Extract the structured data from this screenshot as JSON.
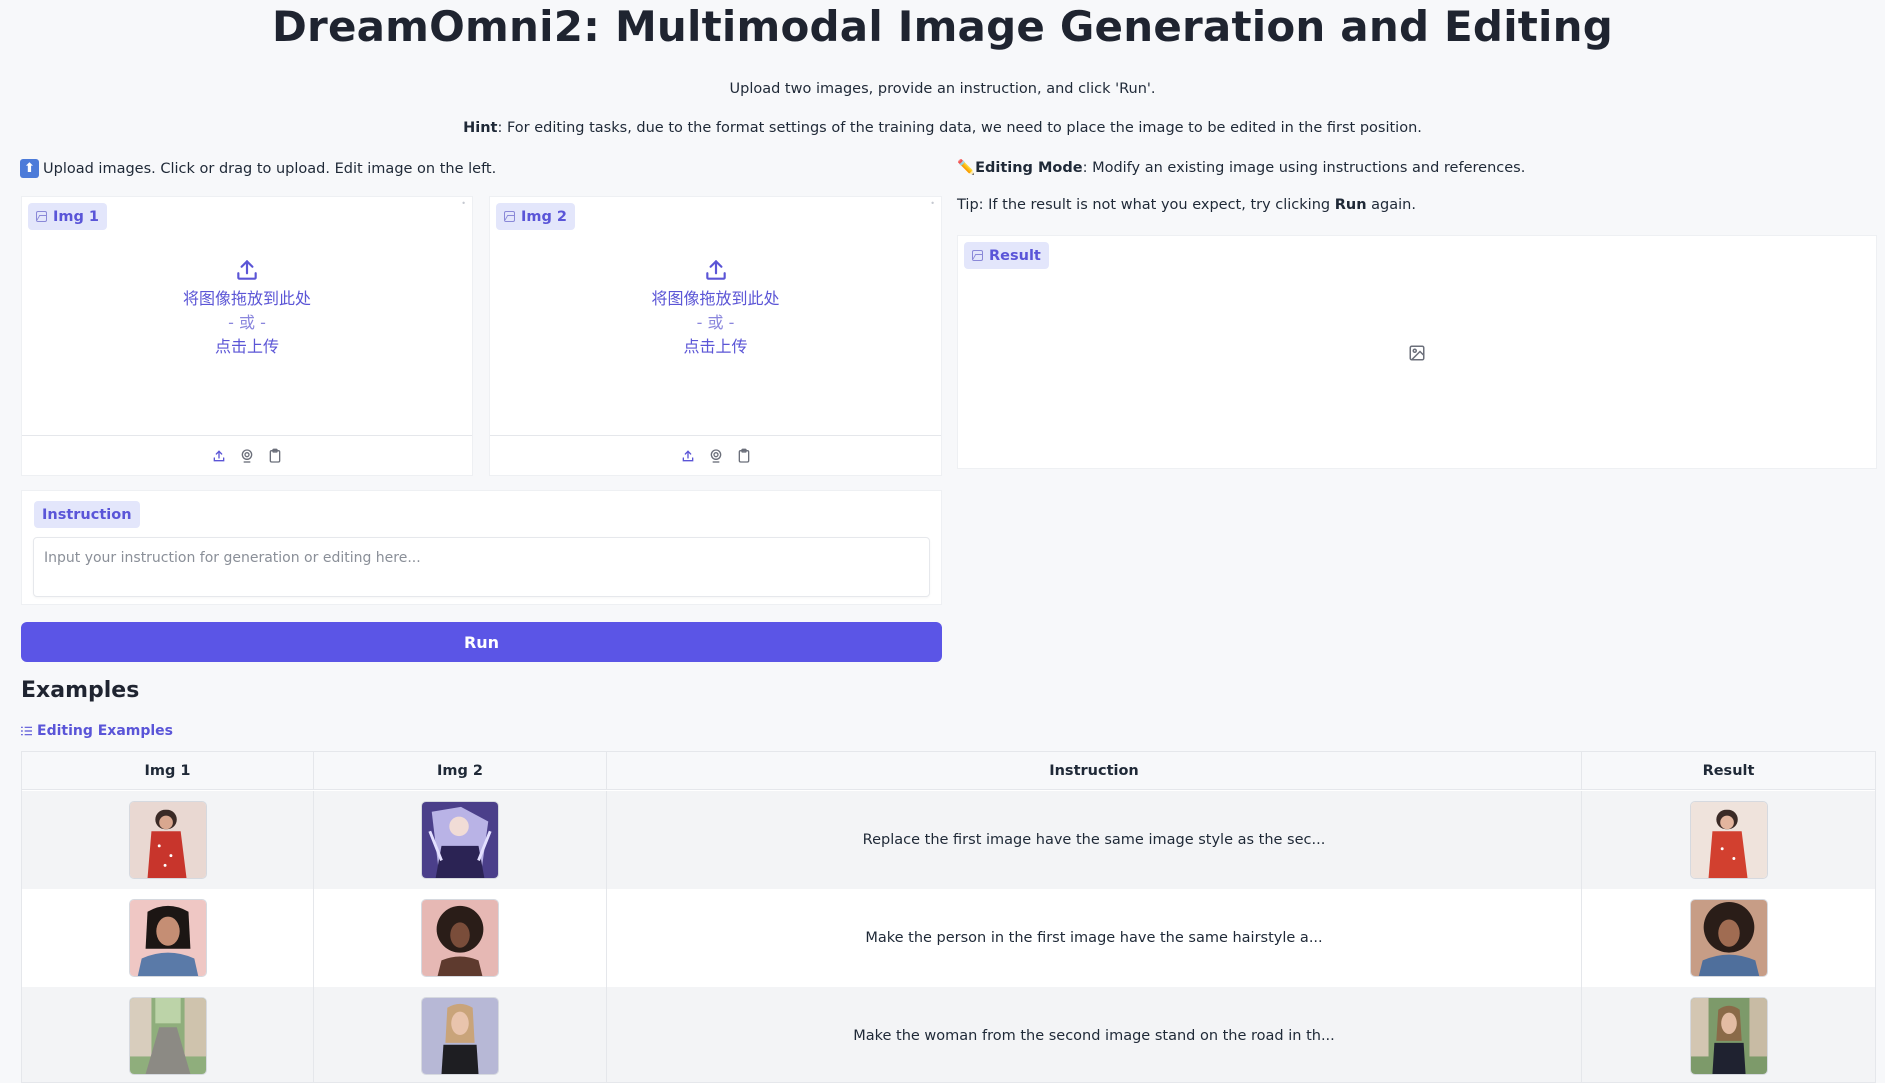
{
  "title": "DreamOmni2: Multimodal Image Generation and Editing",
  "subtitle": "Upload two images, provide an instruction, and click 'Run'.",
  "hint": {
    "label": "Hint",
    "text": ": For editing tasks, due to the format settings of the training data, we need to place the image to be edited in the first position."
  },
  "upload_note": {
    "emoji": "⬆",
    "text": "Upload images. Click or drag to upload. Edit image on the left."
  },
  "mode_note": {
    "emoji": "✏️",
    "label": "Editing Mode",
    "text": ": Modify an existing image using instructions and references."
  },
  "tip_note": {
    "prefix": "Tip: If the result is not what you expect, try clicking ",
    "bold": "Run",
    "suffix": " again."
  },
  "img1": {
    "label": "Img 1",
    "drop_text": "将图像拖放到此处",
    "or_text": "- 或 -",
    "click_text": "点击上传"
  },
  "img2": {
    "label": "Img 2",
    "drop_text": "将图像拖放到此处",
    "or_text": "- 或 -",
    "click_text": "点击上传"
  },
  "result": {
    "label": "Result"
  },
  "instruction": {
    "label": "Instruction",
    "placeholder": "Input your instruction for generation or editing here..."
  },
  "run_label": "Run",
  "examples": {
    "title": "Examples",
    "subtitle": "Editing Examples",
    "headers": [
      "Img 1",
      "Img 2",
      "Instruction",
      "Result"
    ],
    "rows": [
      {
        "instruction": "Replace the first image have the same image style as the sec..."
      },
      {
        "instruction": "Make the person in the first image have the same hairstyle a..."
      },
      {
        "instruction": "Make the woman from the second image stand on the road in th..."
      }
    ]
  },
  "colors": {
    "accent": "#5b55e6",
    "chip_bg": "#e3e6fb",
    "chip_text": "#5a55d8",
    "background": "#f7f8fa"
  },
  "icons": {
    "upload": "upload-icon",
    "webcam": "webcam-icon",
    "clipboard": "clipboard-icon",
    "image": "image-icon",
    "list": "list-icon"
  }
}
